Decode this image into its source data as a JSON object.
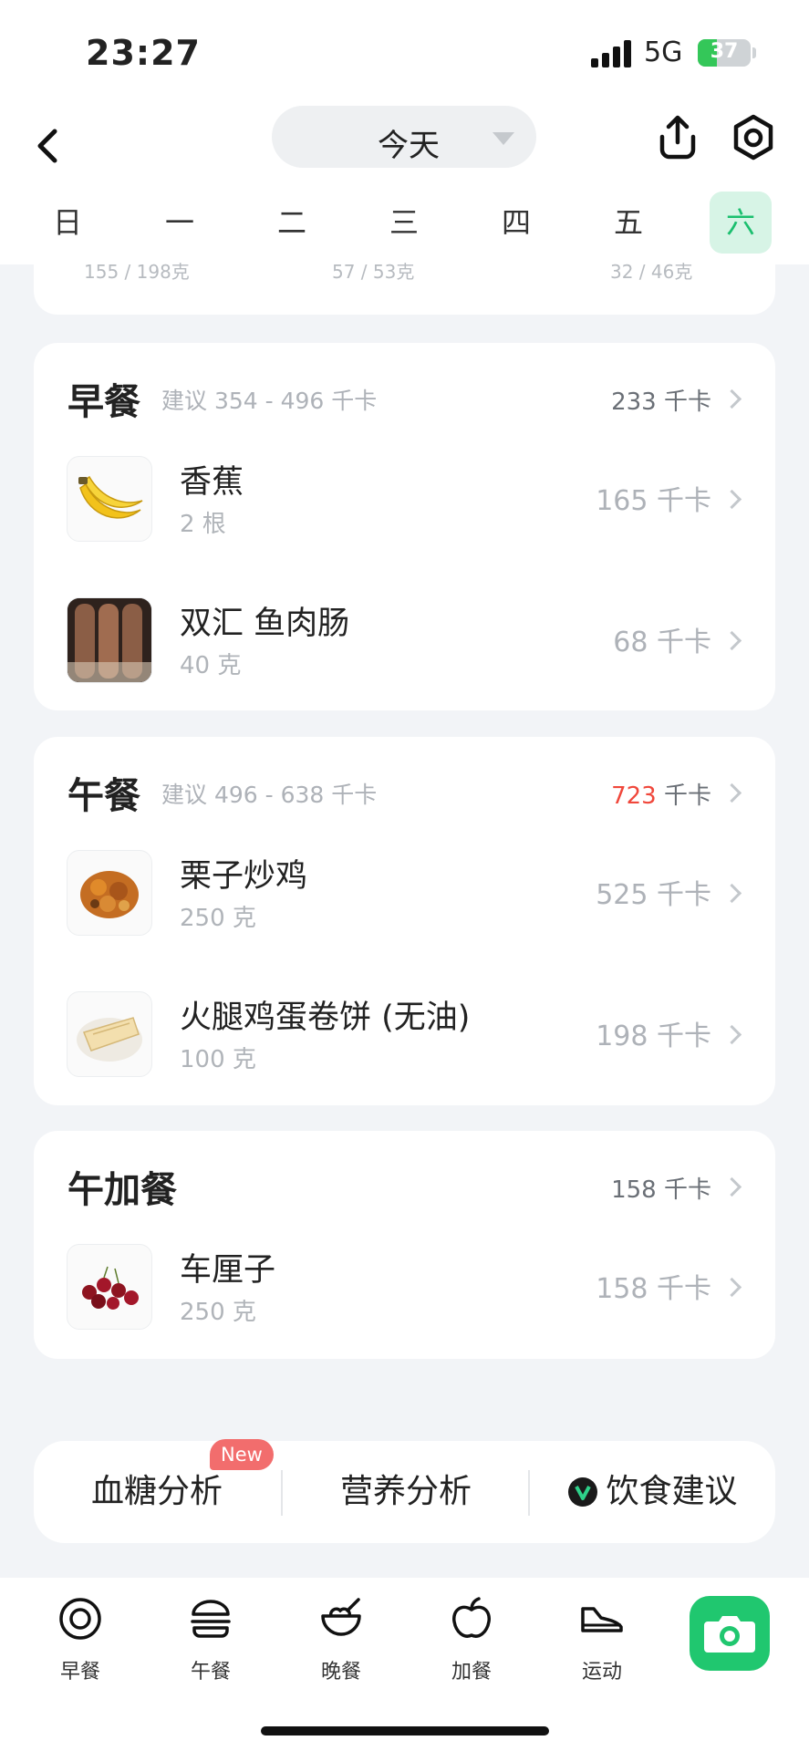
{
  "status_bar": {
    "time": "23:27",
    "network": "5G",
    "battery": "37"
  },
  "header": {
    "date_selector": "今天"
  },
  "weekdays": [
    "日",
    "一",
    "二",
    "三",
    "四",
    "五",
    "六"
  ],
  "summary_peek": [
    "155 / 198克",
    "57 / 53克",
    "32 / 46克"
  ],
  "meals": {
    "breakfast": {
      "title": "早餐",
      "suggestion": "建议 354 - 496 千卡",
      "total_value": "233",
      "total_unit": "千卡",
      "items": [
        {
          "name": "香蕉",
          "qty": "2 根",
          "cal": "165 千卡"
        },
        {
          "name": "双汇 鱼肉肠",
          "qty": "40 克",
          "cal": "68 千卡"
        }
      ]
    },
    "lunch": {
      "title": "午餐",
      "suggestion": "建议 496 - 638 千卡",
      "total_value": "723",
      "total_unit": "千卡",
      "items": [
        {
          "name": "栗子炒鸡",
          "qty": "250 克",
          "cal": "525 千卡"
        },
        {
          "name": "火腿鸡蛋卷饼 (无油)",
          "qty": "100 克",
          "cal": "198 千卡"
        }
      ]
    },
    "afternoon_snack": {
      "title": "午加餐",
      "total_value": "158",
      "total_unit": "千卡",
      "items": [
        {
          "name": "车厘子",
          "qty": "250 克",
          "cal": "158 千卡"
        }
      ]
    }
  },
  "analysis": {
    "badge": "New",
    "blood_sugar": "血糖分析",
    "nutrition": "营养分析",
    "diet_advice": "饮食建议"
  },
  "bottom_nav": {
    "breakfast": "早餐",
    "lunch": "午餐",
    "dinner": "晚餐",
    "snack": "加餐",
    "exercise": "运动"
  },
  "colors": {
    "accent": "#20c76f",
    "over_limit": "#f0473b"
  }
}
